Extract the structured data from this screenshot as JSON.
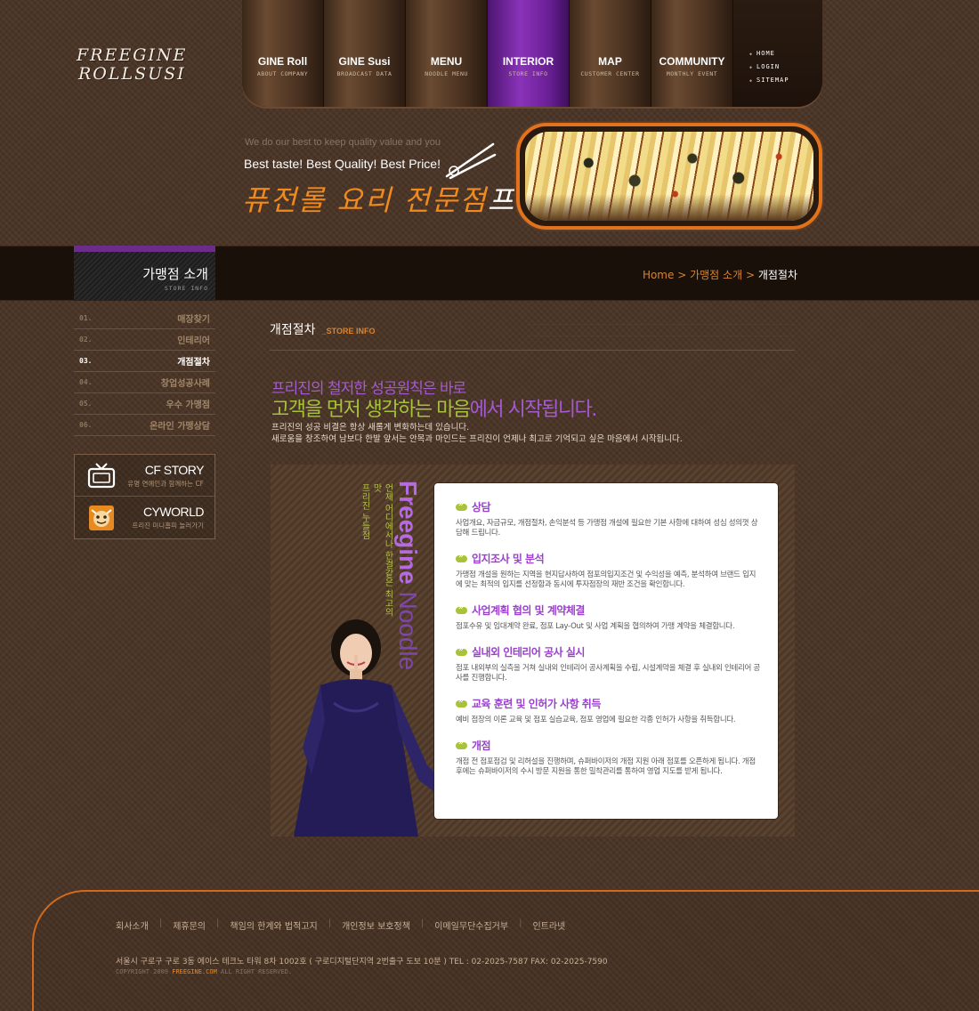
{
  "logo": {
    "line1": "FREEGINE",
    "line2": "ROLLSUSI"
  },
  "nav": {
    "items": [
      {
        "title": "GINE Roll",
        "sub": "ABOUT COMPANY"
      },
      {
        "title": "GINE Susi",
        "sub": "BROADCAST DATA"
      },
      {
        "title": "MENU",
        "sub": "NOODLE MENU"
      },
      {
        "title": "INTERIOR",
        "sub": "STORE INFO"
      },
      {
        "title": "MAP",
        "sub": "CUSTOMER CENTER"
      },
      {
        "title": "COMMUNITY",
        "sub": "MONTHLY EVENT"
      }
    ],
    "active_index": 3,
    "utility": [
      "HOME",
      "LOGIN",
      "SITEMAP"
    ]
  },
  "hero": {
    "sub": "We do our best to keep quality value and you",
    "tagline": "Best taste! Best Quality! Best Price!",
    "title": "퓨전롤 요리 전문점",
    "title_brand": "프리진!"
  },
  "section": {
    "title": "가맹점 소개",
    "sub": "STORE INFO",
    "breadcrumb": {
      "home": "Home",
      "sep": ">",
      "parent": "가맹점 소개",
      "current": "개점절차"
    }
  },
  "sidebar": {
    "items": [
      {
        "num": "01.",
        "label": "매장찾기"
      },
      {
        "num": "02.",
        "label": "인테리어"
      },
      {
        "num": "03.",
        "label": "개점절차"
      },
      {
        "num": "04.",
        "label": "창업성공사례"
      },
      {
        "num": "05.",
        "label": "우수 가맹점"
      },
      {
        "num": "06.",
        "label": "온라인 가맹상담"
      }
    ],
    "active_index": 2,
    "banners": [
      {
        "title": "CF STORY",
        "sub": "유명 연예인과 함께하는 CF",
        "icon": "tv-icon"
      },
      {
        "title": "CYWORLD",
        "sub": "프리진 미니홈피 놀러가기",
        "icon": "cyworld-icon"
      }
    ]
  },
  "content": {
    "title": "개점절차",
    "title_sub": "_STORE INFO",
    "intro_line1": "프리진의 철저한 성공원칙은 바로",
    "intro_line2_green": "고객을 먼저 생각하는 마음",
    "intro_line2_purple": "에서 시작됩니다.",
    "intro_p1": "프리진의 성공 비결은 항상 새롭게 변화하는데 있습니다.",
    "intro_p2": "새로움을 창조하여 남보다 한발 앞서는 안목과 마인드는 프리진이 언제나 최고로 기억되고 싶은 마음에서 시작됩니다.",
    "brand_bold": "Freegine",
    "brand_light": "Noodle",
    "brand_sub1": "언제 어디에서나 한결같은 최고의 맛",
    "brand_sub2": "프리진 누들점",
    "steps": [
      {
        "title": "상담",
        "desc": "사업개요, 자금규모, 개점절차, 손익분석 등 가맹점 개설에 필요한 기본 사항에 대하여 성심 성의껏 상담해 드립니다."
      },
      {
        "title": "입지조사 및 분석",
        "desc": "가맹점 개설을 원하는 지역을 현지답사하여 점포의입지조건 및 수익성을 예측, 분석하여 브랜드 입지에 맞는 최적의 입지를 선정함과 동시에 투자점장의 재반 조건을 확인합니다."
      },
      {
        "title": "사업계획 협의 및 계약체결",
        "desc": "점포수유 및 임대계약 완료, 점포 Lay-Out 및 사업 계획을 협의하여 가맹 계약을 체결합니다."
      },
      {
        "title": "실내외 인테리어 공사 실시",
        "desc": "점포 내외부의 실측을 거쳐 실내외 인테리어 공사계획을 수립, 시설계약을 체결 후 실내외 인테리어 공사를 진행합니다."
      },
      {
        "title": "교육 훈련 및 인허가 사항 취득",
        "desc": "예비 점장의 이론 교육 및 점포 실습교육, 점포 영업에 필요한 각종 인허가 사항을 취득합니다."
      },
      {
        "title": "개점",
        "desc": "개점 전 점포점검 및 리허설을 진행하며, 슈퍼바이저의 개점 지원 아래 점포를 오픈하게 됩니다. 개점 후에는 슈퍼바이저의 수시 방문 지원을 통한 밀착관리를 통하여 영업 지도를 받게 됩니다."
      }
    ]
  },
  "footer": {
    "links": [
      "회사소개",
      "제휴문의",
      "책임의 한계와 법적고지",
      "개인정보 보호정책",
      "이메일무단수집거부",
      "인트라넷"
    ],
    "address": "서울시 구로구 구로 3동 에이스 테크노 타워 8차 1002호 ( 구로디지털단지역 2번출구 도보 10분 )   TEL : 02-2025-7587   FAX: 02-2025-7590",
    "copyright_pre": "COPYRIGHT 2009",
    "copyright_brand": "FREEGINE.COM",
    "copyright_post": "ALL RIGHT RESERVED."
  },
  "colors": {
    "accent_orange": "#e2721c",
    "accent_purple": "#8a33b9",
    "accent_green": "#a8c23a",
    "background": "#4a3526"
  }
}
